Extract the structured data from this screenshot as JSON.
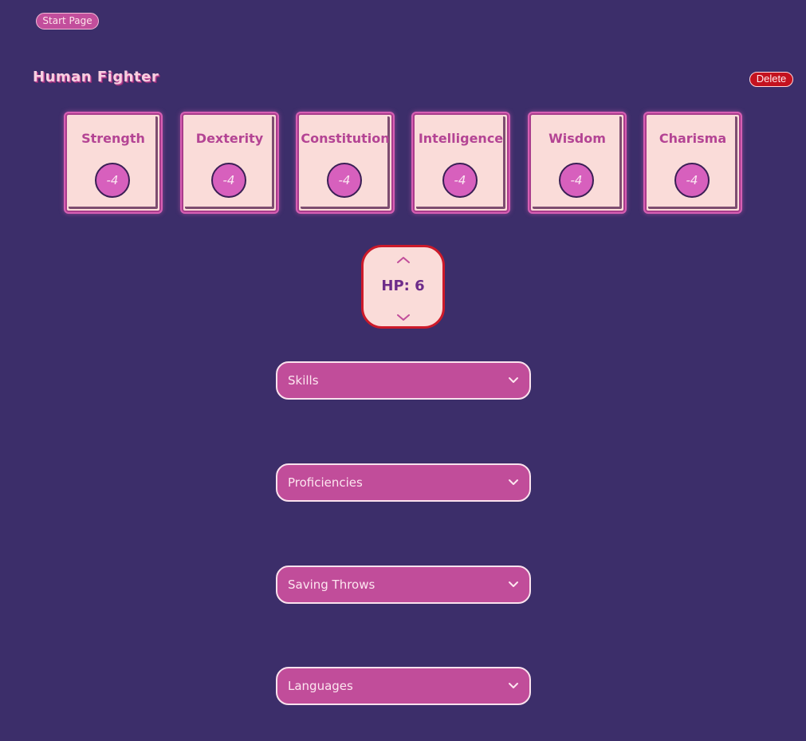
{
  "nav": {
    "start_label": "Start Page"
  },
  "character": {
    "title": "Human  Fighter",
    "delete_label": "Delete"
  },
  "stats": [
    {
      "name": "Strength",
      "modifier": "-4"
    },
    {
      "name": "Dexterity",
      "modifier": "-4"
    },
    {
      "name": "Constitution",
      "modifier": "-4"
    },
    {
      "name": "Intelligence",
      "modifier": "-4"
    },
    {
      "name": "Wisdom",
      "modifier": "-4"
    },
    {
      "name": "Charisma",
      "modifier": "-4"
    }
  ],
  "hp": {
    "label": "HP: 6"
  },
  "sections": [
    {
      "label": "Skills"
    },
    {
      "label": "Proficiencies"
    },
    {
      "label": "Saving Throws"
    },
    {
      "label": "Languages"
    }
  ],
  "colors": {
    "background": "#3c2e6a",
    "accent": "#c14d9a",
    "card": "#fadcd9",
    "danger": "#c4121f"
  },
  "icons": {
    "hp_up": "chevron-up-icon",
    "hp_down": "chevron-down-icon",
    "section_toggle": "chevron-down-icon"
  }
}
